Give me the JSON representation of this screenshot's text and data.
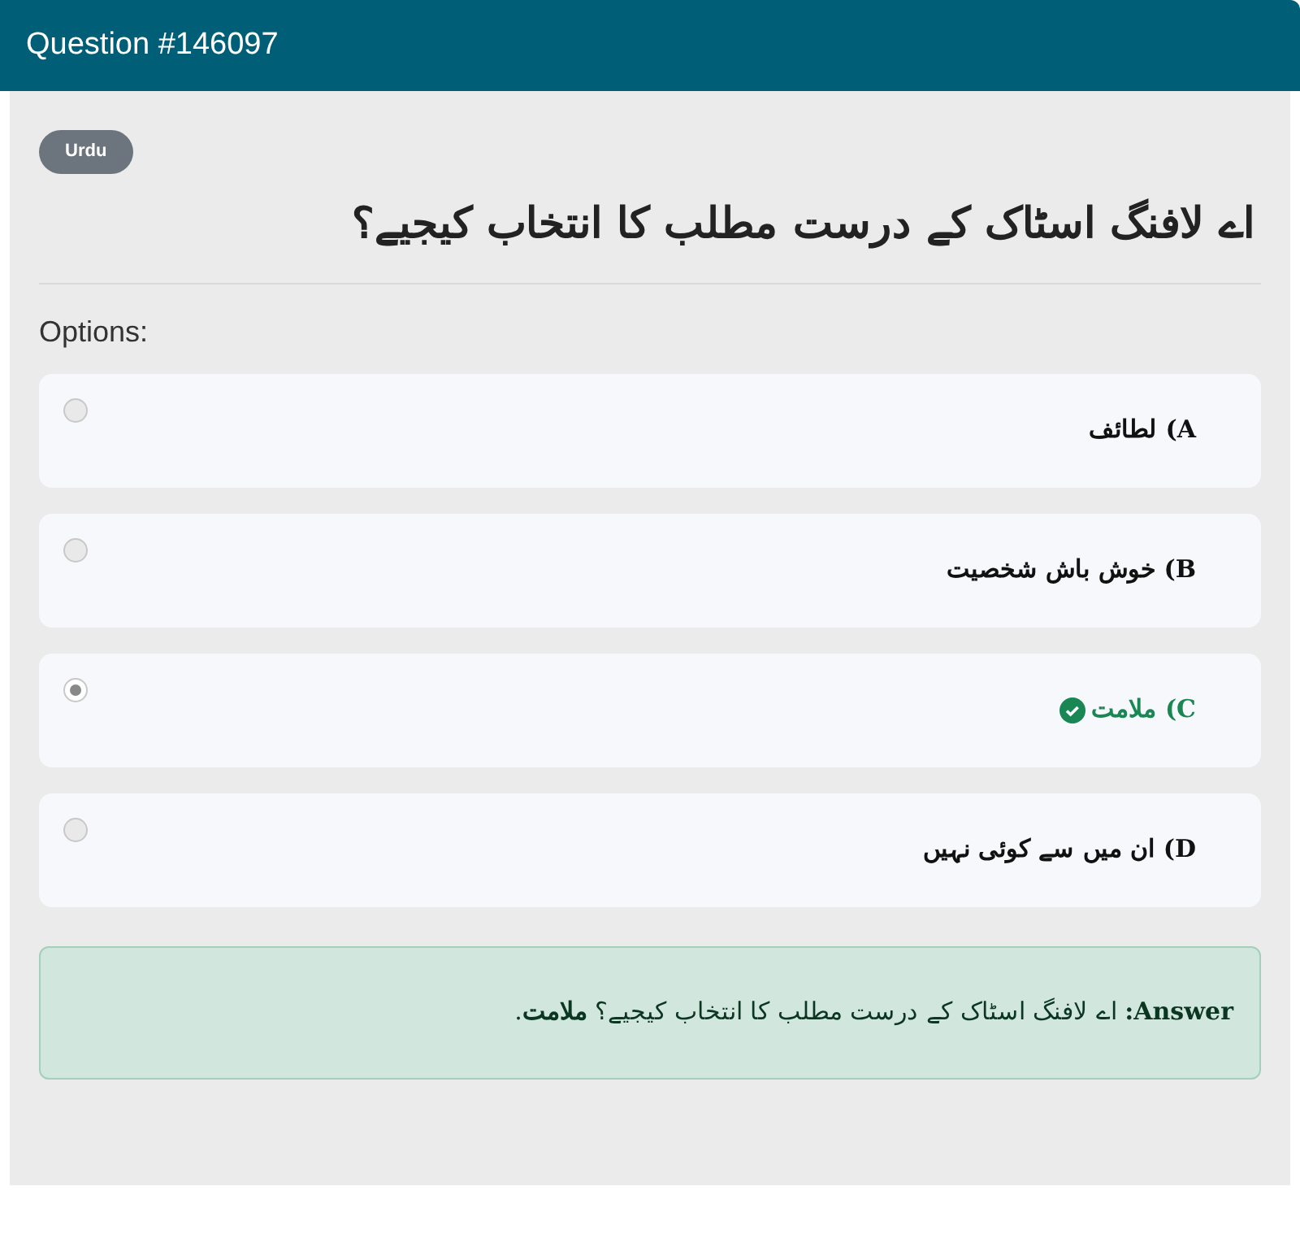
{
  "header": {
    "title": "Question #146097"
  },
  "badge": "Urdu",
  "question": "اے لافنگ اسٹاک کے درست مطلب کا انتخاب کیجیے؟",
  "options_label": "Options:",
  "options": [
    {
      "letter": "A)",
      "text": "لطائف",
      "selected": false,
      "correct": false
    },
    {
      "letter": "B)",
      "text": "خوش باش شخصیت",
      "selected": false,
      "correct": false
    },
    {
      "letter": "C)",
      "text": "ملامت",
      "selected": true,
      "correct": true
    },
    {
      "letter": "D)",
      "text": "ان میں سے کوئی نہیں",
      "selected": false,
      "correct": false
    }
  ],
  "answer": "**Answer:** اے لافنگ اسٹاک کے درست مطلب کا انتخاب کیجیے؟ **ملامت**."
}
